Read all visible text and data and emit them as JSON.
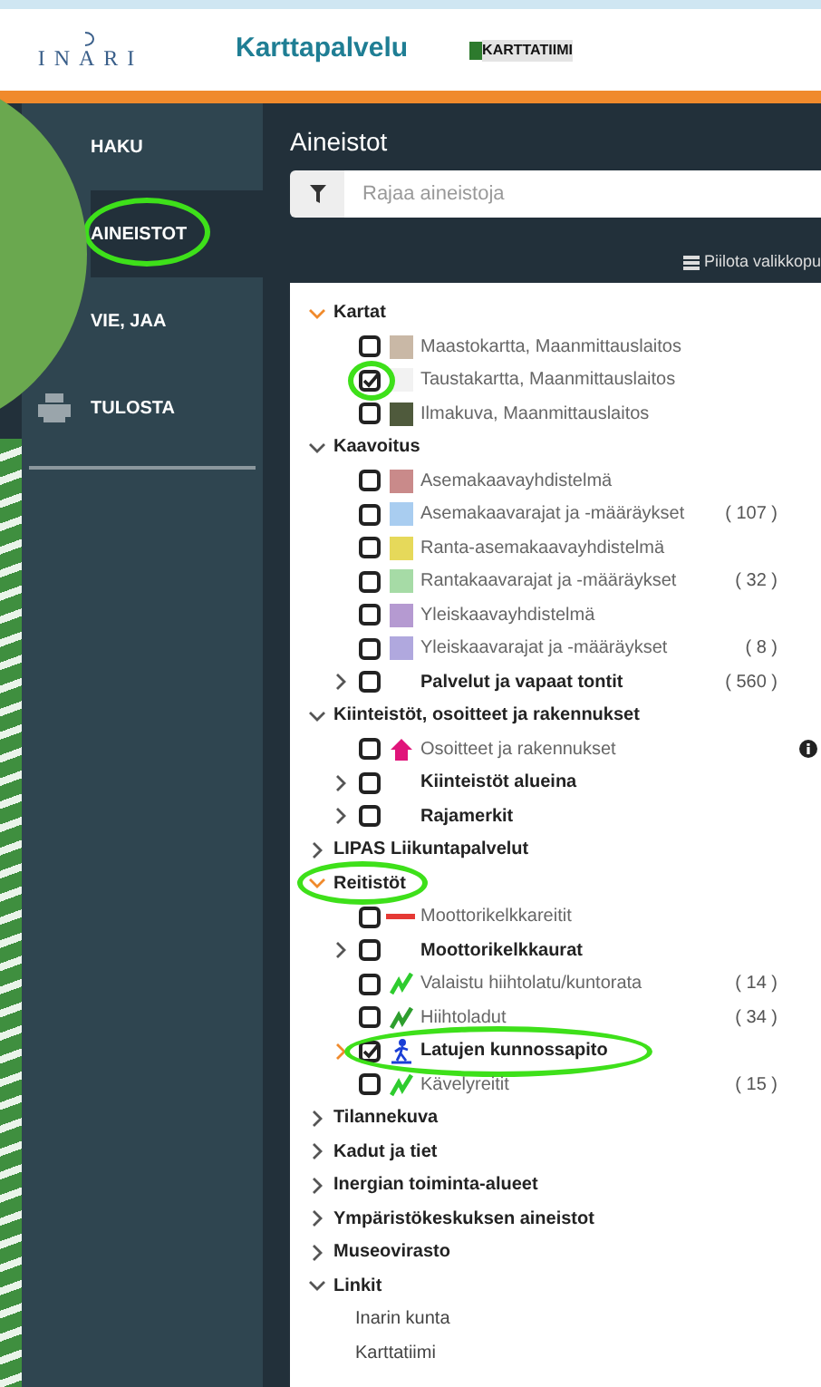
{
  "header": {
    "logo": "INARI",
    "title": "Karttapalvelu",
    "partner": "KARTTATIIMI"
  },
  "sidebar": {
    "items": [
      {
        "label": "HAKU",
        "selected": false
      },
      {
        "label": "AINEISTOT",
        "selected": true,
        "circled": true
      },
      {
        "label": "VIE, JAA",
        "selected": false
      },
      {
        "label": "TULOSTA",
        "selected": false
      }
    ]
  },
  "panel": {
    "title": "Aineistot",
    "filter": {
      "placeholder": "Rajaa aineistoja"
    },
    "hide_button": "Piilota valikkopu",
    "tree": [
      {
        "label": "Kartat",
        "expanded": true,
        "active": true,
        "children": [
          {
            "kind": "thumb",
            "label": "Maastokartta, Maanmittauslaitos",
            "checked": false,
            "color": "#c9b8a6"
          },
          {
            "kind": "thumb",
            "label": "Taustakartta, Maanmittauslaitos",
            "checked": true,
            "color": "#f2f2f2",
            "circled": true
          },
          {
            "kind": "thumb",
            "label": "Ilmakuva, Maanmittauslaitos",
            "checked": false,
            "color": "#4f5a3c"
          }
        ]
      },
      {
        "label": "Kaavoitus",
        "expanded": true,
        "active": false,
        "children": [
          {
            "kind": "thumb",
            "label": "Asemakaavayhdistelmä",
            "checked": false,
            "color": "#c98a8a"
          },
          {
            "kind": "thumb",
            "label": "Asemakaavarajat ja -määräykset",
            "count": "( 107 )",
            "checked": false,
            "color": "#a9cdf0"
          },
          {
            "kind": "thumb",
            "label": "Ranta-asemakaavayhdistelmä",
            "checked": false,
            "color": "#e6d95a"
          },
          {
            "kind": "thumb",
            "label": "Rantakaavarajat ja -määräykset",
            "count": "( 32 )",
            "checked": false,
            "color": "#a6dba6"
          },
          {
            "kind": "thumb",
            "label": "Yleiskaavayhdistelmä",
            "checked": false,
            "color": "#b59ad1"
          },
          {
            "kind": "thumb",
            "label": "Yleiskaavarajat ja -määräykset",
            "count": "( 8 )",
            "checked": false,
            "color": "#b0a8de"
          },
          {
            "kind": "group",
            "label": "Palvelut ja vapaat tontit",
            "count": "( 560 )",
            "checked": false,
            "active": false
          }
        ]
      },
      {
        "label": "Kiinteistöt, osoitteet ja rakennukset",
        "expanded": true,
        "active": false,
        "children": [
          {
            "kind": "house",
            "label": "Osoitteet ja rakennukset",
            "checked": false,
            "color": "#e0147a",
            "info": true
          },
          {
            "kind": "group",
            "label": "Kiinteistöt alueina",
            "checked": false,
            "active": false
          },
          {
            "kind": "group",
            "label": "Rajamerkit",
            "checked": false,
            "active": false
          }
        ]
      },
      {
        "label": "LIPAS Liikuntapalvelut",
        "expanded": false,
        "active": false
      },
      {
        "label": "Reitistöt",
        "expanded": true,
        "active": true,
        "circled": true,
        "children": [
          {
            "kind": "line",
            "label": "Moottorikelkkareitit",
            "checked": false,
            "color": "#e53935"
          },
          {
            "kind": "group",
            "label": "Moottorikelkkaurat",
            "checked": false,
            "active": false
          },
          {
            "kind": "trail",
            "label": "Valaistu hiihtolatu/kuntorata",
            "count": "( 14 )",
            "checked": false,
            "color": "#2ecc2e"
          },
          {
            "kind": "trail",
            "label": "Hiihtoladut",
            "count": "( 34 )",
            "checked": false,
            "color": "#2e9e2e"
          },
          {
            "kind": "skier",
            "label": "Latujen kunnossapito",
            "checked": true,
            "active": true,
            "color": "#1a3fd6",
            "circled": true
          },
          {
            "kind": "trail",
            "label": "Kävelyreitit",
            "count": "( 15 )",
            "checked": false,
            "color": "#2ecc2e"
          }
        ]
      },
      {
        "label": "Tilannekuva",
        "expanded": false,
        "active": false
      },
      {
        "label": "Kadut ja tiet",
        "expanded": false,
        "active": false
      },
      {
        "label": "Inergian toiminta-alueet",
        "expanded": false,
        "active": false
      },
      {
        "label": "Ympäristökeskuksen aineistot",
        "expanded": false,
        "active": false
      },
      {
        "label": "Museovirasto",
        "expanded": false,
        "active": false
      },
      {
        "label": "Linkit",
        "expanded": true,
        "active": false,
        "children": [
          {
            "kind": "link",
            "label": "Inarin kunta"
          },
          {
            "kind": "link",
            "label": "Karttatiimi"
          }
        ]
      }
    ]
  }
}
